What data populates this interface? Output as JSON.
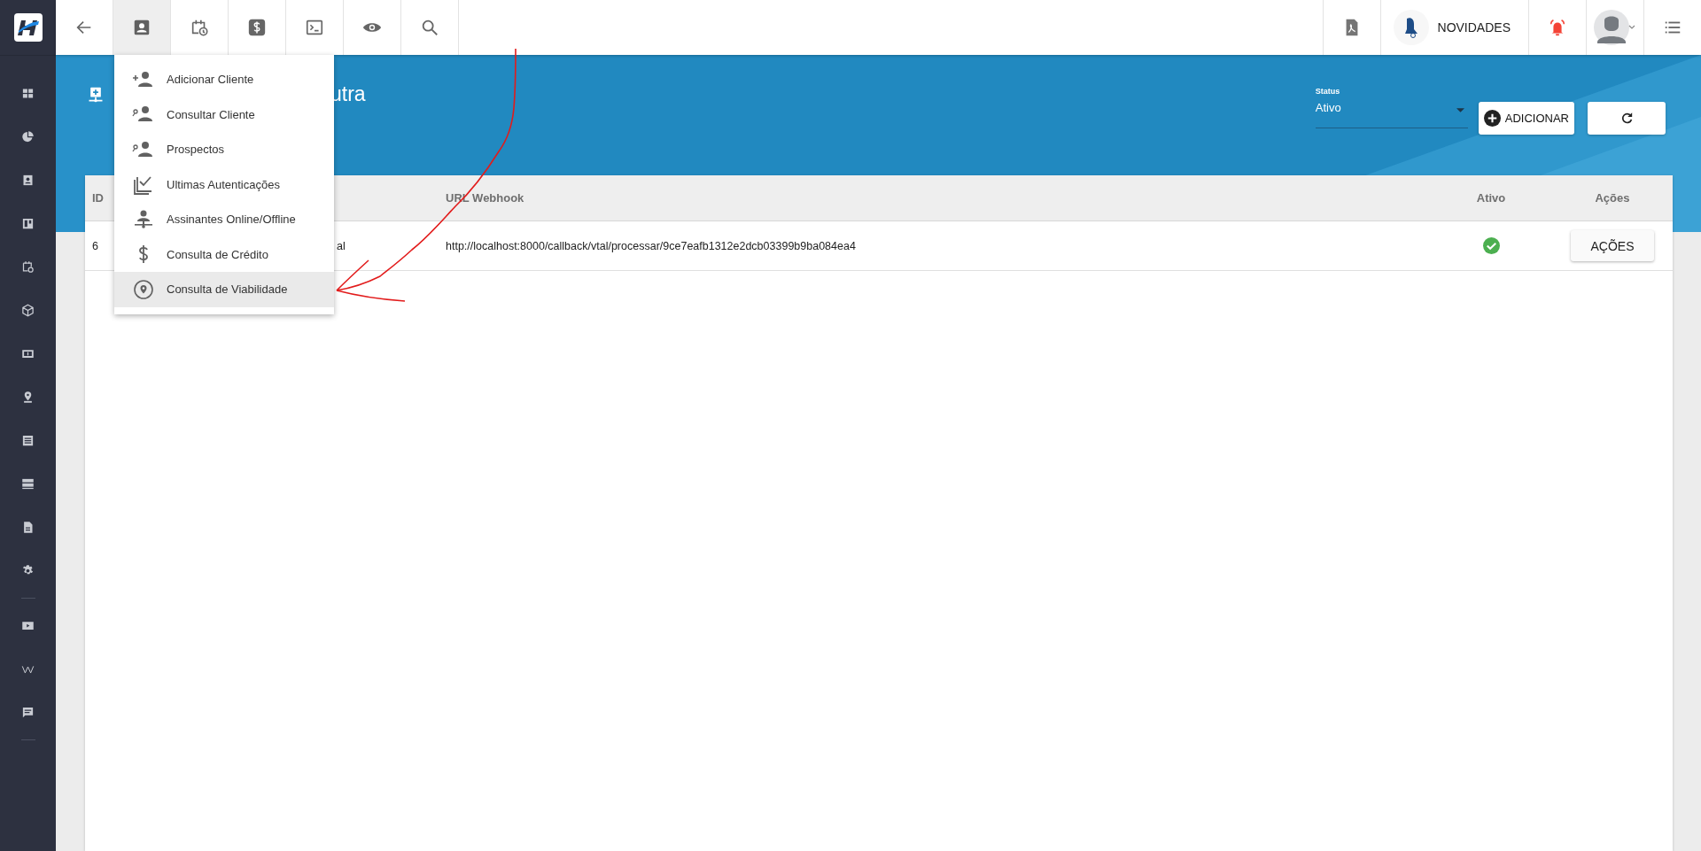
{
  "toolbar": [
    {
      "selected": false
    },
    {
      "selected": true
    },
    {
      "selected": false
    },
    {
      "selected": false
    },
    {
      "selected": false
    },
    {
      "selected": false
    },
    {
      "selected": false
    }
  ],
  "news": {
    "label": "NOVIDADES"
  },
  "page": {
    "title": "utra"
  },
  "status": {
    "label": "Status",
    "value": "Ativo"
  },
  "buttons": {
    "add": "ADICIONAR"
  },
  "menu": [
    {
      "label": "Adicionar Cliente",
      "selected": false
    },
    {
      "label": "Consultar Cliente",
      "selected": false
    },
    {
      "label": "Prospectos",
      "selected": false
    },
    {
      "label": "Ultimas Autenticações",
      "selected": false
    },
    {
      "label": "Assinantes Online/Offline",
      "selected": false
    },
    {
      "label": "Consulta de Crédito",
      "selected": false
    },
    {
      "label": "Consulta de Viabilidade",
      "selected": true
    }
  ],
  "table": {
    "columns": [
      {
        "label": "ID"
      },
      {
        "label": "URL Webhook"
      },
      {
        "label": "Ativo"
      },
      {
        "label": "Ações"
      }
    ],
    "rows": [
      {
        "id": "6",
        "column_2": "al",
        "url": "http://localhost:8000/callback/vtal/processar/9ce7eafb1312e2dcb03399b9ba084ea4",
        "active": true,
        "action": "AÇÕES"
      }
    ]
  }
}
